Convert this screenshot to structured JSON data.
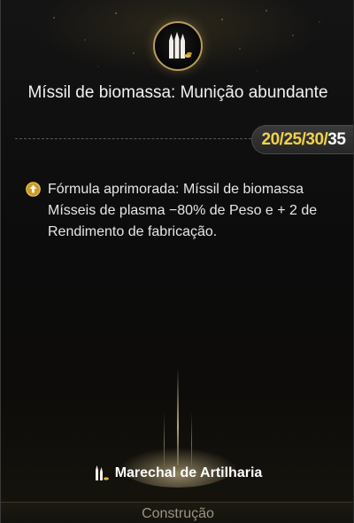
{
  "card": {
    "icon": "ammo-icon",
    "title": "Míssil de biomassa: Munição abundante",
    "levels": {
      "highlighted": "20/25/30/",
      "current": "35"
    },
    "bonus": {
      "icon": "upgrade-arrow-icon",
      "lines": [
        "Fórmula aprimorada: Míssil de biomassa",
        "Mísseis de plasma −80% de Peso e + 2 de Rendimento de fabricação."
      ]
    },
    "class": {
      "icon": "artillery-icon",
      "label": "Marechal de Artilharia"
    },
    "tab_label": "Construção"
  },
  "colors": {
    "accent_gold": "#f2d24a",
    "medallion_border": "#b89b5a",
    "tab_text": "#9b9381"
  }
}
